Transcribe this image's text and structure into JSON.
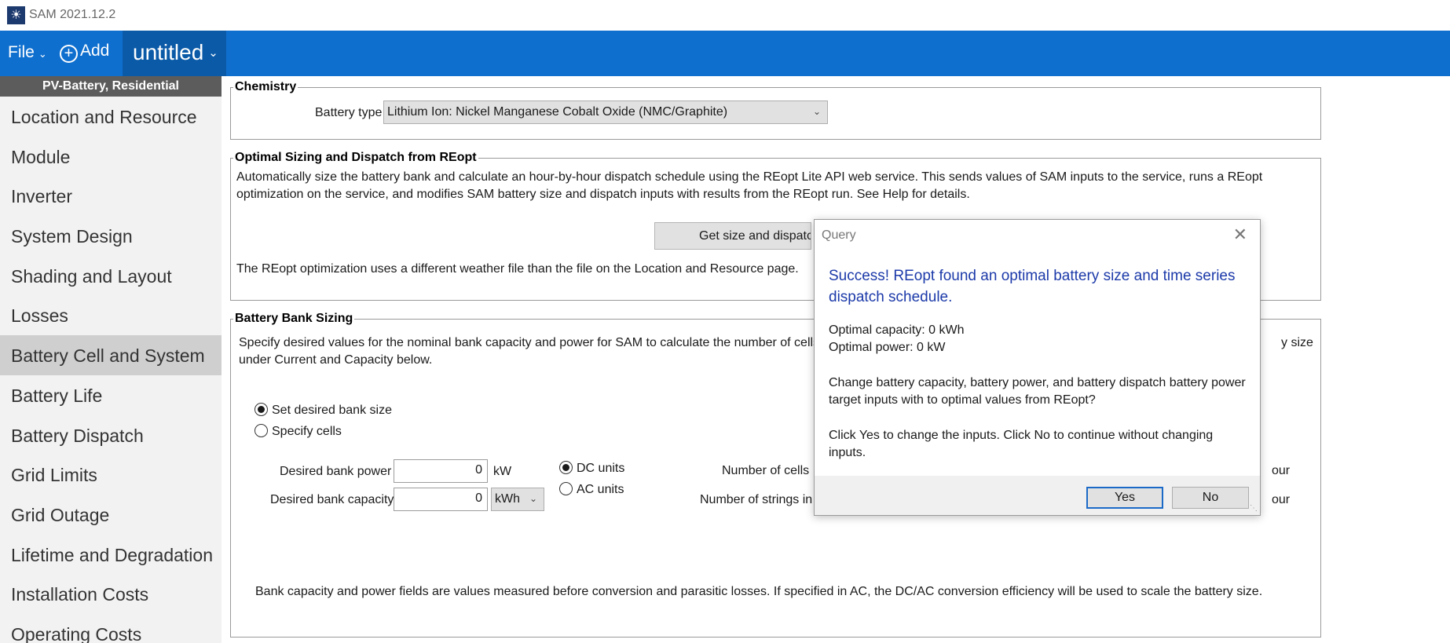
{
  "window": {
    "title": "SAM 2021.12.2"
  },
  "toolbar": {
    "file_label": "File",
    "add_label": "Add",
    "project_name": "untitled"
  },
  "sidebar": {
    "header": "PV-Battery, Residential",
    "items": [
      {
        "label": "Location and Resource"
      },
      {
        "label": "Module"
      },
      {
        "label": "Inverter"
      },
      {
        "label": "System Design"
      },
      {
        "label": "Shading and Layout"
      },
      {
        "label": "Losses"
      },
      {
        "label": "Battery Cell and System",
        "active": true
      },
      {
        "label": "Battery Life"
      },
      {
        "label": "Battery Dispatch"
      },
      {
        "label": "Grid Limits"
      },
      {
        "label": "Grid Outage"
      },
      {
        "label": "Lifetime and Degradation"
      },
      {
        "label": "Installation Costs"
      },
      {
        "label": "Operating Costs"
      }
    ]
  },
  "chemistry": {
    "legend": "Chemistry",
    "battery_type_label": "Battery type",
    "battery_type_value": "Lithium Ion: Nickel Manganese Cobalt Oxide (NMC/Graphite)"
  },
  "reopt": {
    "legend": "Optimal Sizing and Dispatch from REopt",
    "description": "Automatically size the battery bank and calculate an hour-by-hour dispatch schedule using the REopt Lite API web service. This sends values of SAM inputs to the service, runs a REopt optimization on the service, and modifies SAM battery size and dispatch inputs with results from the REopt run. See Help for details.",
    "button_label": "Get size and dispatch",
    "weather_note": "The REopt optimization uses a different weather file than the file on the Location and Resource page."
  },
  "sizing": {
    "legend": "Battery Bank Sizing",
    "description": "Specify desired values for the nominal bank capacity and power for SAM to calculate the number of cells",
    "description_tail": "y size",
    "description_line2": "under Current and Capacity below.",
    "radio_set_size": "Set desired bank size",
    "radio_specify_cells": "Specify cells",
    "bank_power_label": "Desired bank power",
    "bank_power_value": "0",
    "bank_power_unit": "kW",
    "bank_capacity_label": "Desired bank capacity",
    "bank_capacity_value": "0",
    "bank_capacity_unit": "kWh",
    "radio_dc_units": "DC units",
    "radio_ac_units": "AC units",
    "num_cells_label": "Number of cells",
    "num_strings_label": "Number of strings in",
    "right_text_1": "our",
    "right_text_2": "our",
    "footnote": "Bank capacity and power fields are values measured before conversion and parasitic losses. If specified in AC, the DC/AC conversion efficiency will be used to scale the battery size."
  },
  "dialog": {
    "title": "Query",
    "heading": "Success! REopt found an optimal battery size and time series dispatch schedule.",
    "capacity_line": "Optimal capacity: 0 kWh",
    "power_line": "Optimal power: 0 kW",
    "question": "Change battery capacity, battery power, and battery dispatch battery power target inputs with to optimal values from REopt?",
    "instruction": "Click Yes to change the inputs. Click No to continue without changing inputs.",
    "yes_label": "Yes",
    "no_label": "No"
  }
}
